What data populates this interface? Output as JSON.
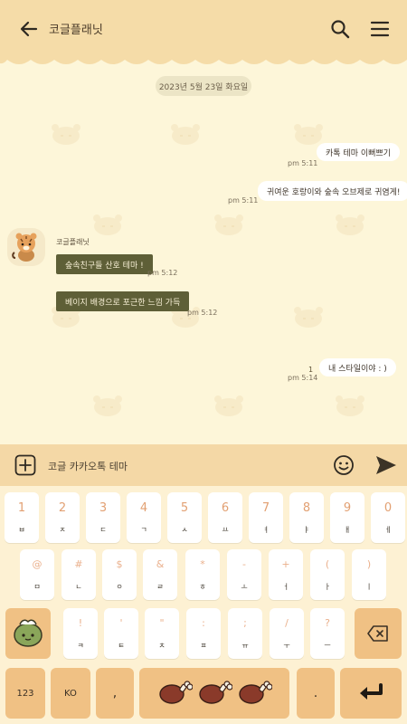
{
  "header": {
    "title": "코글플래닛"
  },
  "chat": {
    "date": "2023년 5월 23일 화요일",
    "sender_name": "코글플래닛",
    "messages_out": [
      {
        "text": "카톡 테마 이뻐쁘기",
        "time": "pm 5:11"
      },
      {
        "text": "귀여운 호랑이와 숲속 오브제로 귀염게!",
        "time": "pm 5:11"
      },
      {
        "text": "내 스타일이야 : )",
        "time": "pm 5:14",
        "unread": "1"
      }
    ],
    "messages_in": [
      {
        "text": "숲속친구들 산호 테마 !",
        "time": "pm 5:12"
      },
      {
        "text": "베이지 배경으로 포근한 느낌 가득",
        "time": "pm 5:12"
      }
    ]
  },
  "input": {
    "text": "코글 카카오톡 테마"
  },
  "keyboard": {
    "row1": [
      {
        "top": "1",
        "bot": "ㅂ"
      },
      {
        "top": "2",
        "bot": "ㅈ"
      },
      {
        "top": "3",
        "bot": "ㄷ"
      },
      {
        "top": "4",
        "bot": "ㄱ"
      },
      {
        "top": "5",
        "bot": "ㅅ"
      },
      {
        "top": "6",
        "bot": "ㅛ"
      },
      {
        "top": "7",
        "bot": "ㅕ"
      },
      {
        "top": "8",
        "bot": "ㅑ"
      },
      {
        "top": "9",
        "bot": "ㅐ"
      },
      {
        "top": "0",
        "bot": "ㅔ"
      }
    ],
    "row2": [
      {
        "top": "@",
        "bot": "ㅁ"
      },
      {
        "top": "#",
        "bot": "ㄴ"
      },
      {
        "top": "$",
        "bot": "ㅇ"
      },
      {
        "top": "&",
        "bot": "ㄹ"
      },
      {
        "top": "*",
        "bot": "ㅎ"
      },
      {
        "top": "-",
        "bot": "ㅗ"
      },
      {
        "top": "+",
        "bot": "ㅓ"
      },
      {
        "top": "(",
        "bot": "ㅏ"
      },
      {
        "top": ")",
        "bot": "ㅣ"
      }
    ],
    "row3": [
      {
        "top": "!",
        "bot": "ㅋ"
      },
      {
        "top": "'",
        "bot": "ㅌ"
      },
      {
        "top": "\"",
        "bot": "ㅊ"
      },
      {
        "top": ":",
        "bot": "ㅍ"
      },
      {
        "top": ";",
        "bot": "ㅠ"
      },
      {
        "top": "/",
        "bot": "ㅜ"
      },
      {
        "top": "?",
        "bot": "ㅡ"
      }
    ],
    "num_label": "123",
    "lang_label": "KO",
    "comma_label": ",",
    "period_label": "."
  },
  "colors": {
    "header": "#f5dca8",
    "background": "#fdf6d9",
    "incoming_bubble": "#5e5f37",
    "key_accent": "#f0c184"
  }
}
